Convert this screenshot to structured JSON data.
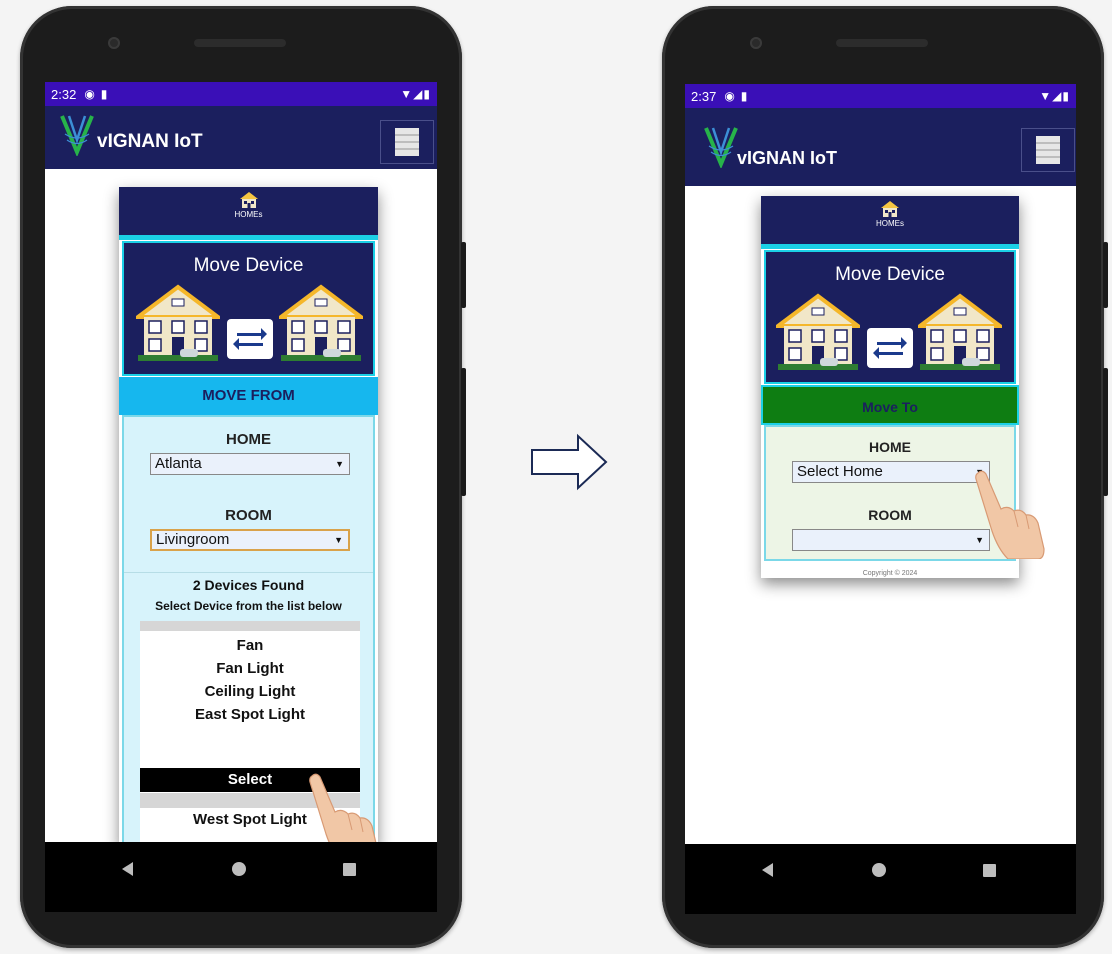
{
  "left_phone": {
    "status_time": "2:32",
    "app_title": "vIGNAN IoT",
    "homes_label": "HOMEs",
    "banner_title": "Move Device",
    "section_title": "MOVE  FROM",
    "home_label": "HOME",
    "home_value": "Atlanta",
    "room_label": "ROOM",
    "room_value": "Livingroom",
    "devices_found": "2 Devices Found",
    "devices_hint": "Select Device from the list below",
    "device_list": [
      "Fan",
      "Fan Light",
      "Ceiling Light",
      "East Spot Light"
    ],
    "select_label": "Select",
    "next_item": "West Spot Light"
  },
  "right_phone": {
    "status_time": "2:37",
    "app_title": "vIGNAN IoT",
    "homes_label": "HOMEs",
    "banner_title": "Move Device",
    "section_title": "Move To",
    "home_label": "HOME",
    "home_value": "Select Home",
    "room_label": "ROOM",
    "room_value": "",
    "copyright": "Copyright © 2024"
  },
  "colors": {
    "navy": "#1b1f5e",
    "status_bar": "#3a0fb7",
    "cyan": "#1bd0e6",
    "move_from_bar": "#16b7ee",
    "move_to_bar": "#0e7d12",
    "from_form_bg": "#d7f3fb",
    "to_form_bg": "#edf5e6"
  },
  "icons": [
    "v-logo-icon",
    "hamburger-menu-icon",
    "homes-house-icon",
    "swap-arrows-icon",
    "tap-hand-icon",
    "flow-arrow-icon",
    "nav-back-icon",
    "nav-home-icon",
    "nav-recent-icon"
  ]
}
